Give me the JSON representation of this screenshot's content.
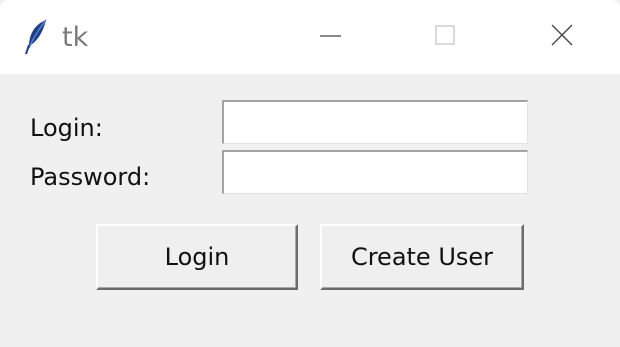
{
  "window": {
    "title": "tk",
    "app_icon": "feather-icon",
    "controls": {
      "minimize_icon": "minimize-icon",
      "maximize_icon": "maximize-icon",
      "close_icon": "close-icon"
    }
  },
  "form": {
    "login_label": "Login:",
    "login_value": "",
    "password_label": "Password:",
    "password_value": ""
  },
  "buttons": {
    "login_label": "Login",
    "create_user_label": "Create User"
  },
  "colors": {
    "window_bg": "#f0f0f0",
    "titlebar_bg": "#ffffff",
    "title_text": "#7a7a7a",
    "icon_blue": "#1e3f8a"
  }
}
